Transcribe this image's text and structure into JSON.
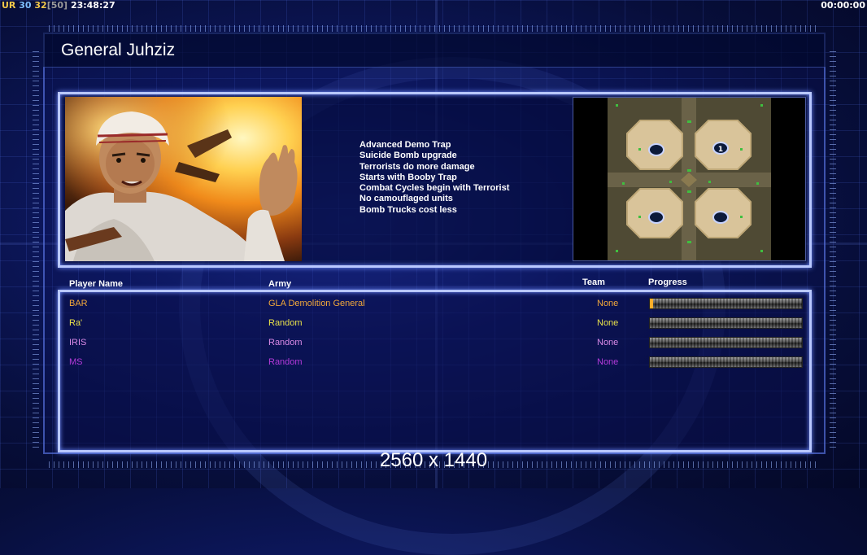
{
  "hud": {
    "ur_label": "UR",
    "fps": "30",
    "fps_alt": "32",
    "fps_cap": "[50]",
    "clock": "23:48:27",
    "timer": "00:00:00"
  },
  "general": {
    "title": "General Juhziz",
    "traits": [
      "Advanced Demo Trap",
      "Suicide Bomb upgrade",
      "Terrorists do more damage",
      "Starts with Booby Trap",
      "Combat Cycles begin with Terrorist",
      "No camouflaged units",
      "Bomb Trucks cost less"
    ],
    "map_start_label": "1"
  },
  "players": {
    "headers": {
      "name": "Player Name",
      "army": "Army",
      "team": "Team",
      "progress": "Progress"
    },
    "rows": [
      {
        "name": "BAR",
        "army": "GLA Demolition General",
        "team": "None",
        "color": "#f2a83a",
        "progress": 0.02
      },
      {
        "name": "Ra'",
        "army": "Random",
        "team": "None",
        "color": "#e8e04a",
        "progress": 0
      },
      {
        "name": "IRIS",
        "army": "Random",
        "team": "None",
        "color": "#d98ae6",
        "progress": 0
      },
      {
        "name": "MS",
        "army": "Random",
        "team": "None",
        "color": "#b43ad9",
        "progress": 0
      }
    ]
  },
  "resolution_label": "2560 x 1440",
  "colors": {
    "panel_border": "#b9c8ff",
    "background": "#0d1860"
  }
}
